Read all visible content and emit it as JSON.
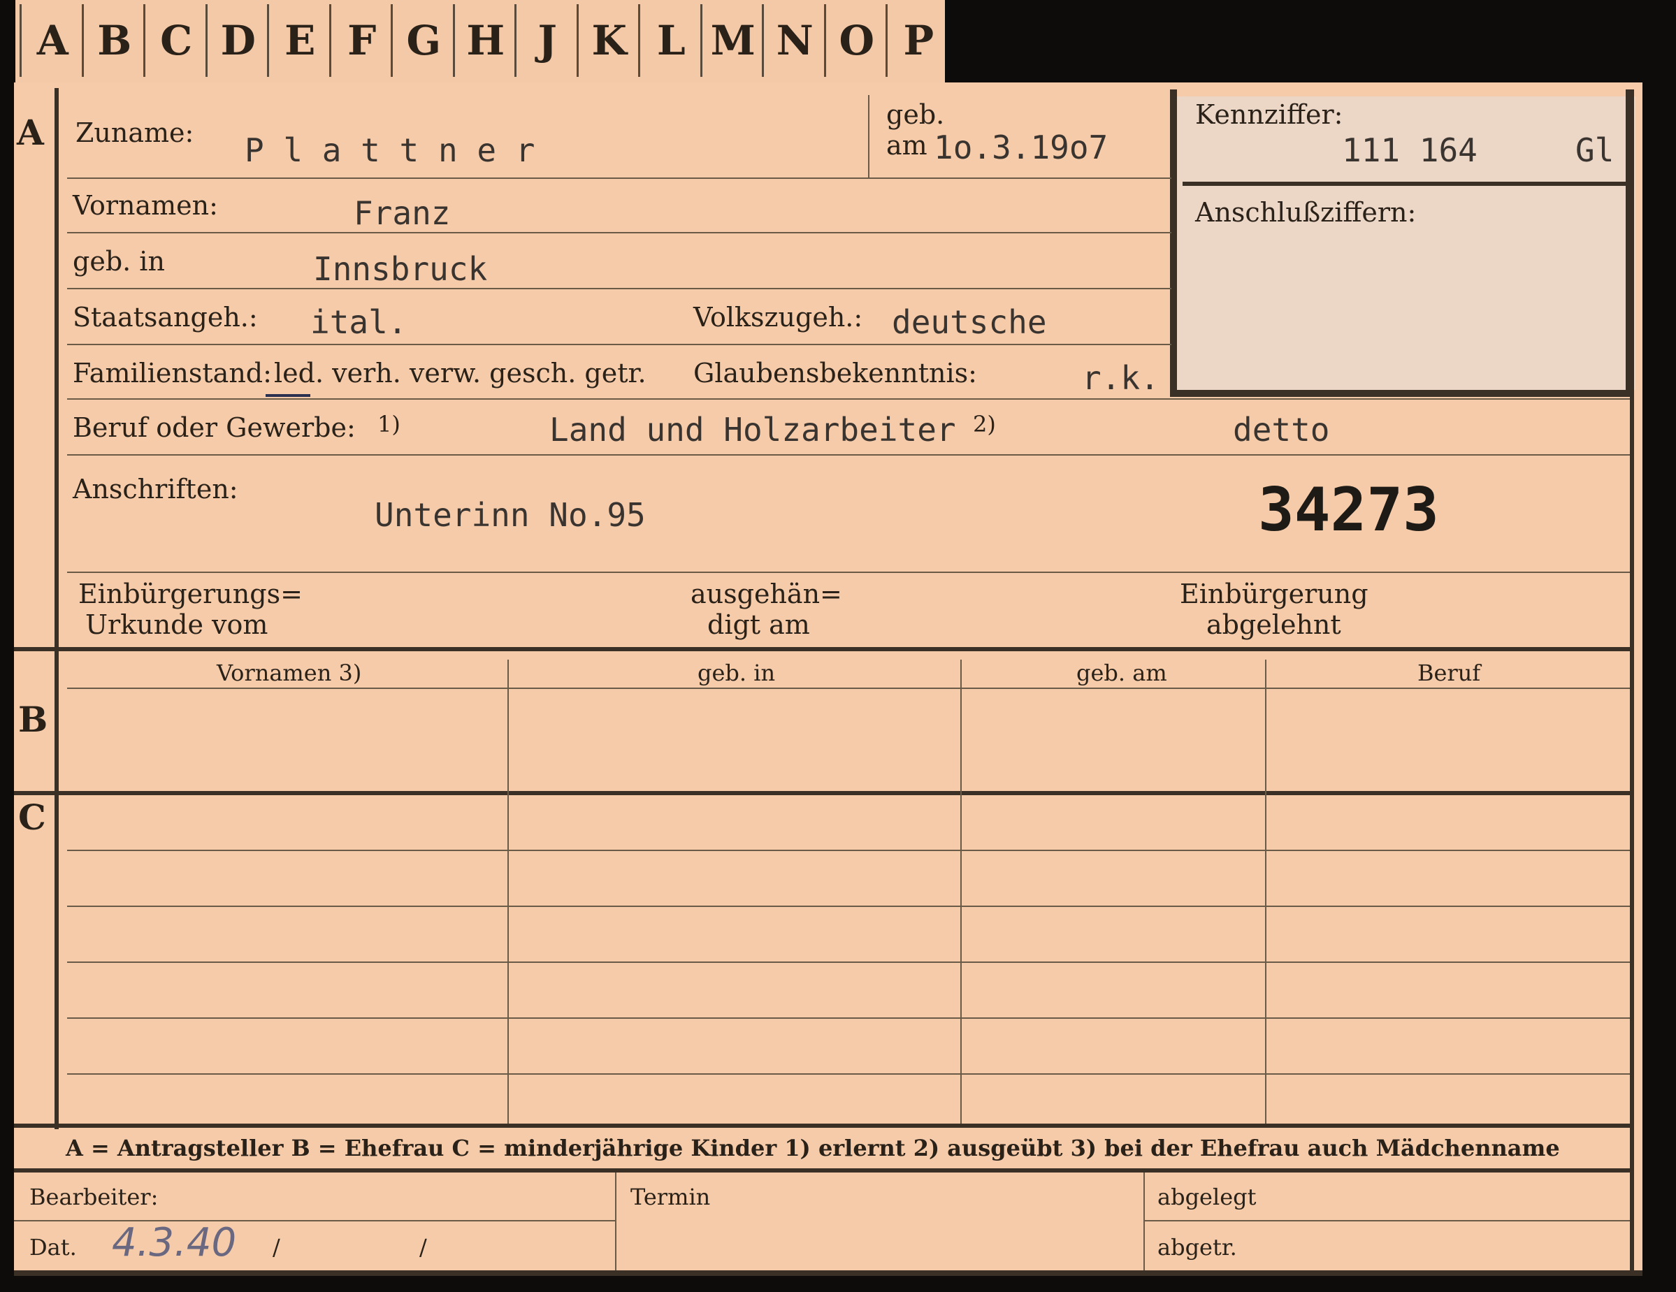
{
  "index_tabs": [
    "A",
    "B",
    "C",
    "D",
    "E",
    "F",
    "G",
    "H",
    "J",
    "K",
    "L",
    "M",
    "N",
    "O",
    "P"
  ],
  "sections": {
    "a": "A",
    "b": "B",
    "c": "C"
  },
  "labels": {
    "zuname": "Zuname:",
    "geb": "geb.",
    "geb_am": "am",
    "kennziffer": "Kennziffer:",
    "anschlussziffern": "Anschlußziffern:",
    "vornamen": "Vornamen:",
    "geb_in": "geb. in",
    "staatsangeh": "Staatsangeh.:",
    "volkszugeh": "Volkszugeh.:",
    "familienstand": "Familienstand:",
    "familienstand_options": "led. verh. verw. gesch. getr.",
    "glaubensbekenntnis": "Glaubensbekenntnis:",
    "beruf": "Beruf oder Gewerbe:",
    "beruf_note": "1)",
    "anschriften": "Anschriften:",
    "einb_urkunde_1": "Einbürgerungs=",
    "einb_urkunde_2": "Urkunde vom",
    "ausgehaen_1": "ausgehän=",
    "ausgehaen_2": "digt am",
    "einb_abgelehnt_1": "Einbürgerung",
    "einb_abgelehnt_2": "abgelehnt"
  },
  "values": {
    "zuname": "P l a t t n e r",
    "geb_am": "1o.3.19o7",
    "kennziffer": "111 164",
    "kennziffer_suffix": "Gl",
    "vornamen": "Franz",
    "geb_in": "Innsbruck",
    "staatsangeh": "ital.",
    "volkszugeh": "deutsche",
    "glaubensbekenntnis": "r.k.",
    "beruf": "Land und Holzarbeiter",
    "beruf_note2": "2)",
    "beruf_2": "detto",
    "anschrift": "Unterinn No.95",
    "stamp_number": "34273"
  },
  "table_headers": [
    "Vornamen 3)",
    "geb. in",
    "geb. am",
    "Beruf"
  ],
  "legend": "A = Antragsteller   B = Ehefrau   C = minderjährige Kinder   1) erlernt   2) ausgeübt   3) bei der Ehefrau auch Mädchenname",
  "footer": {
    "bearbeiter": "Bearbeiter:",
    "dat": "Dat.",
    "dat_value": "4.3.40",
    "slash1": "/",
    "slash2": "/",
    "termin": "Termin",
    "abgelegt": "abgelegt",
    "abgetr": "abgetr."
  }
}
